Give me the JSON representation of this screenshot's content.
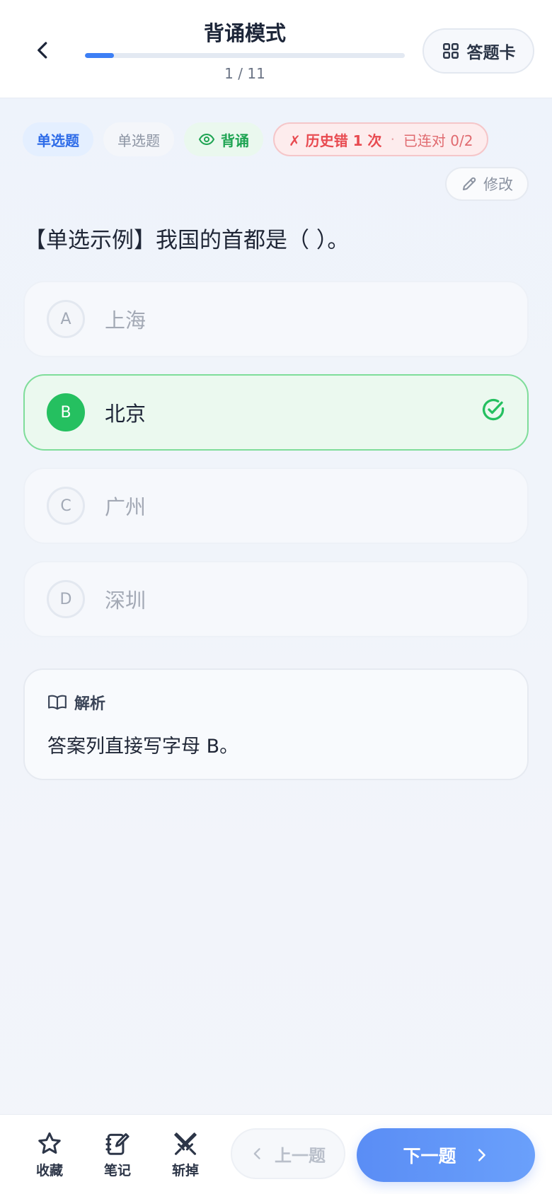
{
  "header": {
    "title": "背诵模式",
    "progress_text": "1 / 11",
    "progress_fraction": 0.09,
    "answer_card_label": "答题卡",
    "back_icon": "chevron-left-icon",
    "answer_card_icon": "grid-icon"
  },
  "tags": {
    "type": "单选题",
    "subtype": "单选题",
    "mode": "背诵",
    "mode_icon": "eye-icon",
    "history_error": "✗ 历史错 1 次",
    "streak": "已连对 0/2"
  },
  "edit_label": "修改",
  "question": {
    "text": "【单选示例】我国的首都是（ ）。",
    "correct_letter": "B",
    "options": [
      {
        "letter": "A",
        "text": "上海"
      },
      {
        "letter": "B",
        "text": "北京"
      },
      {
        "letter": "C",
        "text": "广州"
      },
      {
        "letter": "D",
        "text": "深圳"
      }
    ]
  },
  "analysis": {
    "title": "解析",
    "body": "答案列直接写字母 B。"
  },
  "bottom_bar": {
    "favorite_label": "收藏",
    "notes_label": "笔记",
    "remove_label": "斩掉",
    "prev_label": "上一题",
    "next_label": "下一题"
  },
  "colors": {
    "accent": "#3d7ff5",
    "correct": "#25c060",
    "error": "#e84a50"
  }
}
